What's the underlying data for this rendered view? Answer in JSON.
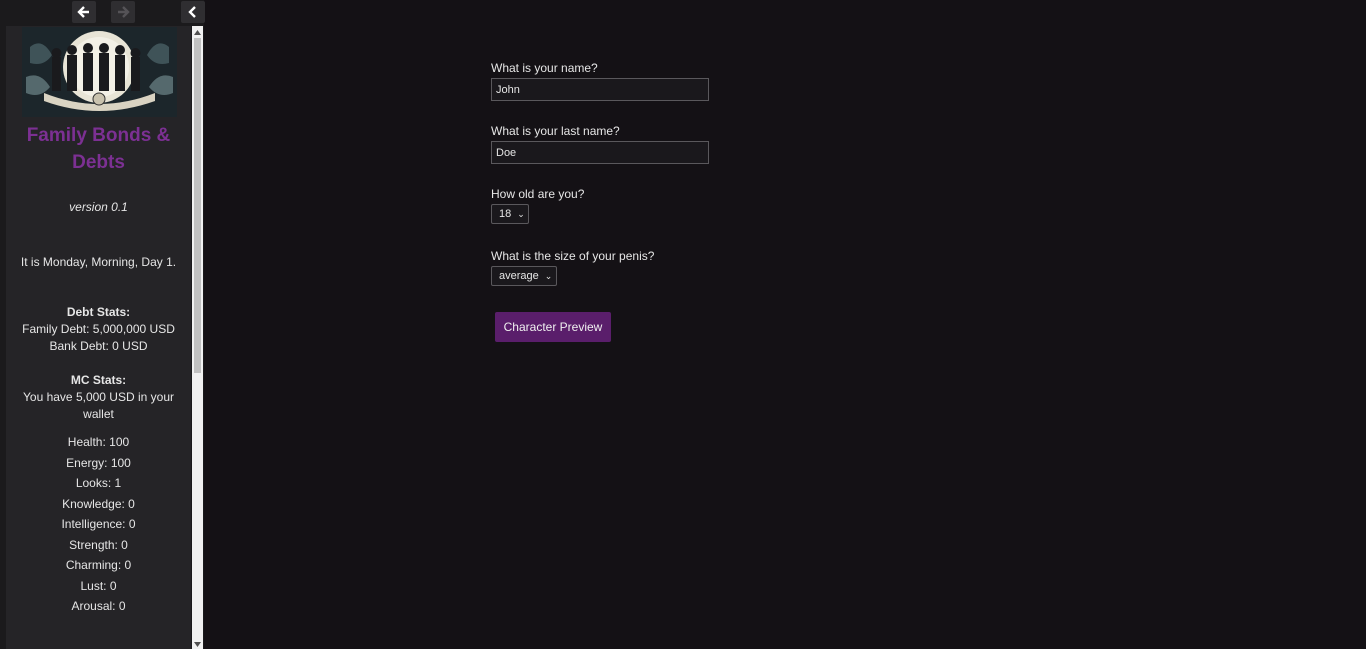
{
  "sidebar": {
    "title": "Family Bonds & Debts",
    "version": "version 0.1",
    "time_text": "It is Monday, Morning, Day 1.",
    "debt_stats": {
      "heading": "Debt Stats:",
      "family_debt": "Family Debt: 5,000,000 USD",
      "bank_debt": "Bank Debt: 0 USD"
    },
    "mc_stats": {
      "heading": "MC Stats:",
      "wallet": "You have 5,000 USD in your wallet",
      "items": [
        "Health: 100",
        "Energy: 100",
        "Looks: 1",
        "Knowledge: 0",
        "Intelligence: 0",
        "Strength: 0",
        "Charming: 0",
        "Lust: 0",
        "Arousal: 0"
      ]
    }
  },
  "form": {
    "name_label": "What is your name?",
    "name_value": "John",
    "last_name_label": "What is your last name?",
    "last_name_value": "Doe",
    "age_label": "How old are you?",
    "age_value": "18",
    "size_label": "What is the size of your penis?",
    "size_value": "average",
    "preview_button": "Character Preview"
  },
  "colors": {
    "title": "#7c3093",
    "button": "#5a1e6b",
    "background": "#141115"
  }
}
